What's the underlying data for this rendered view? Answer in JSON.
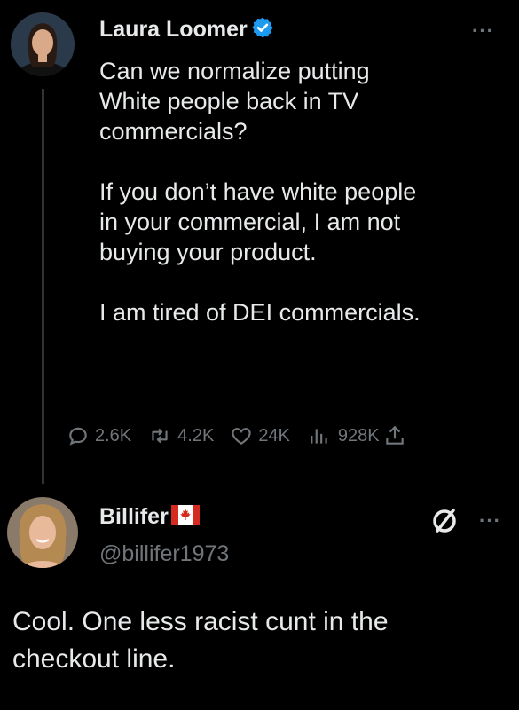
{
  "tweet1": {
    "author": "Laura Loomer",
    "text": "Can we normalize putting\nWhite people back in TV\ncommercials?\n\nIf you don’t have white people\nin your commercial, I am not\nbuying your product.\n\nI am tired of DEI commercials.",
    "more": "···",
    "stats": {
      "replies": "2.6K",
      "reposts": "4.2K",
      "likes": "24K",
      "views": "928K"
    }
  },
  "tweet2": {
    "author": "Billifer",
    "handle": "@billifer1973",
    "text": "Cool. One less racist cunt in the\ncheckout line.",
    "more": "···"
  },
  "icons": [
    "verified-badge-icon",
    "canada-flag-icon",
    "slashed-circle-icon",
    "reply-icon",
    "repost-icon",
    "like-icon",
    "views-icon",
    "share-icon"
  ],
  "colors": {
    "background": "#000000",
    "text": "#e7e9ea",
    "muted": "#71767b",
    "verified": "#1d9bf0"
  }
}
